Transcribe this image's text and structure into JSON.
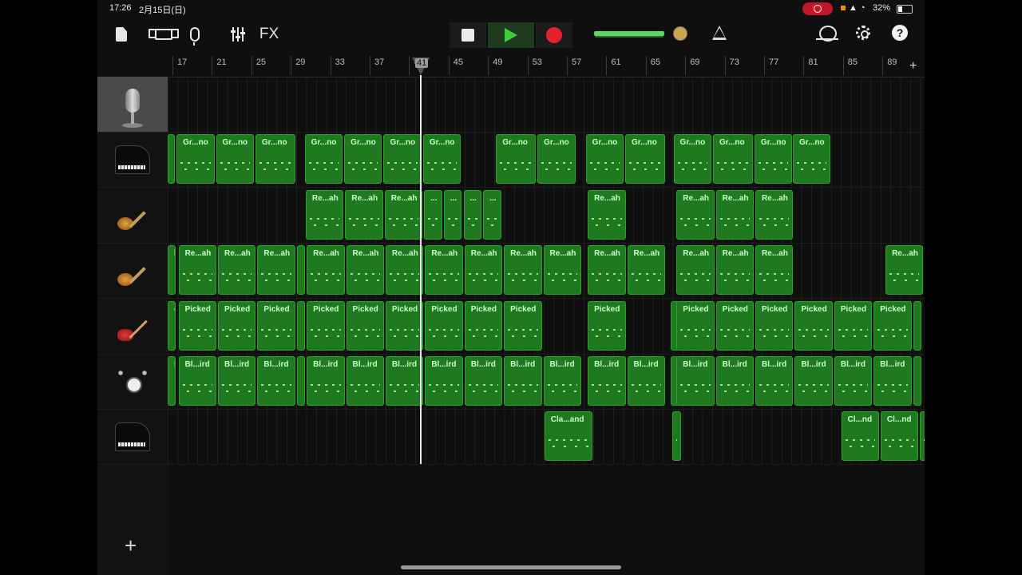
{
  "status_bar": {
    "time": "17:26",
    "date": "2月15日(日)",
    "battery": "32%",
    "signal_icons": "▲ ◔"
  },
  "toolbar": {
    "fx_label": "FX",
    "help_label": "?"
  },
  "ruler": {
    "bars": [
      "17",
      "21",
      "25",
      "29",
      "33",
      "37",
      "41",
      "45",
      "49",
      "53",
      "57",
      "61",
      "65",
      "69",
      "73",
      "77",
      "81",
      "85",
      "89"
    ],
    "playhead_bar": "41",
    "add_label": "+"
  },
  "tracks": [
    {
      "instrument_icon": "microphone-icon",
      "regions": []
    },
    {
      "instrument_icon": "grand-piano-icon",
      "regions": [
        {
          "label": "",
          "start": 0,
          "len": 0.9
        },
        {
          "label": "Gr...no",
          "start": 0.9,
          "len": 4
        },
        {
          "label": "Gr...no",
          "start": 4.9,
          "len": 4
        },
        {
          "label": "Gr...no",
          "start": 8.9,
          "len": 4.2
        },
        {
          "label": "Gr...no",
          "start": 13.9,
          "len": 4
        },
        {
          "label": "Gr...no",
          "start": 17.9,
          "len": 4
        },
        {
          "label": "Gr...no",
          "start": 21.9,
          "len": 4
        },
        {
          "label": "Gr...no",
          "start": 25.9,
          "len": 4
        },
        {
          "label": "Gr...no",
          "start": 33.3,
          "len": 4.2
        },
        {
          "label": "Gr...no",
          "start": 37.5,
          "len": 4
        },
        {
          "label": "Gr...no",
          "start": 42.4,
          "len": 4
        },
        {
          "label": "Gr...no",
          "start": 46.4,
          "len": 4.2
        },
        {
          "label": "Gr...no",
          "start": 51.3,
          "len": 4
        },
        {
          "label": "Gr...no",
          "start": 55.3,
          "len": 4.2
        },
        {
          "label": "Gr...no",
          "start": 59.5,
          "len": 4
        },
        {
          "label": "Gr...no",
          "start": 63.4,
          "len": 4
        }
      ]
    },
    {
      "instrument_icon": "electric-guitar-icon",
      "regions": [
        {
          "label": "Re...ah",
          "start": 14,
          "len": 4
        },
        {
          "label": "Re...ah",
          "start": 18,
          "len": 4
        },
        {
          "label": "Re...ah",
          "start": 22,
          "len": 4
        },
        {
          "label": "...",
          "start": 26,
          "len": 2
        },
        {
          "label": "...",
          "start": 28,
          "len": 2
        },
        {
          "label": "...",
          "start": 30,
          "len": 2
        },
        {
          "label": "...",
          "start": 32,
          "len": 2
        },
        {
          "label": "Re...ah",
          "start": 42.6,
          "len": 4
        },
        {
          "label": "Re...ah",
          "start": 51.6,
          "len": 4
        },
        {
          "label": "Re...ah",
          "start": 55.6,
          "len": 4
        },
        {
          "label": "Re...ah",
          "start": 59.6,
          "len": 4
        }
      ]
    },
    {
      "instrument_icon": "electric-guitar-icon",
      "regions": [
        {
          "label": "h",
          "start": 0,
          "len": 1
        },
        {
          "label": "Re...ah",
          "start": 1.1,
          "len": 4
        },
        {
          "label": "Re...ah",
          "start": 5.1,
          "len": 4
        },
        {
          "label": "Re...ah",
          "start": 9.1,
          "len": 4
        },
        {
          "label": "",
          "start": 13.1,
          "len": 1
        },
        {
          "label": "Re...ah",
          "start": 14.1,
          "len": 4
        },
        {
          "label": "Re...ah",
          "start": 18.1,
          "len": 4
        },
        {
          "label": "Re...ah",
          "start": 22.1,
          "len": 4
        },
        {
          "label": "Re...ah",
          "start": 26.1,
          "len": 4
        },
        {
          "label": "Re...ah",
          "start": 30.1,
          "len": 4
        },
        {
          "label": "Re...ah",
          "start": 34.1,
          "len": 4
        },
        {
          "label": "Re...ah",
          "start": 38.1,
          "len": 4
        },
        {
          "label": "Re...ah",
          "start": 42.6,
          "len": 4
        },
        {
          "label": "Re...ah",
          "start": 46.6,
          "len": 4
        },
        {
          "label": "Re...ah",
          "start": 51.6,
          "len": 4
        },
        {
          "label": "Re...ah",
          "start": 55.6,
          "len": 4
        },
        {
          "label": "Re...ah",
          "start": 59.6,
          "len": 4
        },
        {
          "label": "Re...ah",
          "start": 72.8,
          "len": 4
        }
      ]
    },
    {
      "instrument_icon": "bass-guitar-icon",
      "regions": [
        {
          "label": "d",
          "start": 0,
          "len": 1
        },
        {
          "label": "Picked",
          "start": 1.1,
          "len": 4
        },
        {
          "label": "Picked",
          "start": 5.1,
          "len": 4
        },
        {
          "label": "Picked",
          "start": 9.1,
          "len": 4
        },
        {
          "label": "",
          "start": 13.1,
          "len": 1
        },
        {
          "label": "Picked",
          "start": 14.1,
          "len": 4
        },
        {
          "label": "Picked",
          "start": 18.1,
          "len": 4
        },
        {
          "label": "Picked",
          "start": 22.1,
          "len": 4
        },
        {
          "label": "Picked",
          "start": 26.1,
          "len": 4
        },
        {
          "label": "Picked",
          "start": 30.1,
          "len": 4
        },
        {
          "label": "Picked",
          "start": 34.1,
          "len": 4
        },
        {
          "label": "Picked",
          "start": 42.6,
          "len": 4
        },
        {
          "label": "",
          "start": 51,
          "len": 1
        },
        {
          "label": "Picked",
          "start": 51.6,
          "len": 4
        },
        {
          "label": "Picked",
          "start": 55.6,
          "len": 4
        },
        {
          "label": "Picked",
          "start": 59.6,
          "len": 4
        },
        {
          "label": "Picked",
          "start": 63.6,
          "len": 4
        },
        {
          "label": "Picked",
          "start": 67.6,
          "len": 4
        },
        {
          "label": "Picked",
          "start": 71.6,
          "len": 4
        },
        {
          "label": "",
          "start": 75.6,
          "len": 1
        }
      ]
    },
    {
      "instrument_icon": "drum-kit-icon",
      "regions": [
        {
          "label": "l",
          "start": 0,
          "len": 1
        },
        {
          "label": "Bl...ird",
          "start": 1.1,
          "len": 4
        },
        {
          "label": "Bl...ird",
          "start": 5.1,
          "len": 4
        },
        {
          "label": "Bl...ird",
          "start": 9.1,
          "len": 4
        },
        {
          "label": "",
          "start": 13.1,
          "len": 1
        },
        {
          "label": "Bl...ird",
          "start": 14.1,
          "len": 4
        },
        {
          "label": "Bl...ird",
          "start": 18.1,
          "len": 4
        },
        {
          "label": "Bl...ird",
          "start": 22.1,
          "len": 4
        },
        {
          "label": "Bl...ird",
          "start": 26.1,
          "len": 4
        },
        {
          "label": "Bl...ird",
          "start": 30.1,
          "len": 4
        },
        {
          "label": "Bl...ird",
          "start": 34.1,
          "len": 4
        },
        {
          "label": "Bl...ird",
          "start": 38.1,
          "len": 4
        },
        {
          "label": "Bl...ird",
          "start": 42.6,
          "len": 4
        },
        {
          "label": "Bl...ird",
          "start": 46.6,
          "len": 4
        },
        {
          "label": "",
          "start": 51,
          "len": 1
        },
        {
          "label": "Bl...ird",
          "start": 51.6,
          "len": 4
        },
        {
          "label": "Bl...ird",
          "start": 55.6,
          "len": 4
        },
        {
          "label": "Bl...ird",
          "start": 59.6,
          "len": 4
        },
        {
          "label": "Bl...ird",
          "start": 63.6,
          "len": 4
        },
        {
          "label": "Bl...ird",
          "start": 67.6,
          "len": 4
        },
        {
          "label": "Bl...ird",
          "start": 71.6,
          "len": 4
        },
        {
          "label": "",
          "start": 75.6,
          "len": 1
        }
      ]
    },
    {
      "instrument_icon": "grand-piano-icon",
      "regions": [
        {
          "label": "Cla...and",
          "start": 38.2,
          "len": 5
        },
        {
          "label": "",
          "start": 51.2,
          "len": 1
        },
        {
          "label": "Cl...nd",
          "start": 68.3,
          "len": 4
        },
        {
          "label": "Cl...nd",
          "start": 72.3,
          "len": 4
        },
        {
          "label": "",
          "start": 76.3,
          "len": 1
        }
      ]
    }
  ],
  "add_track_label": "+"
}
